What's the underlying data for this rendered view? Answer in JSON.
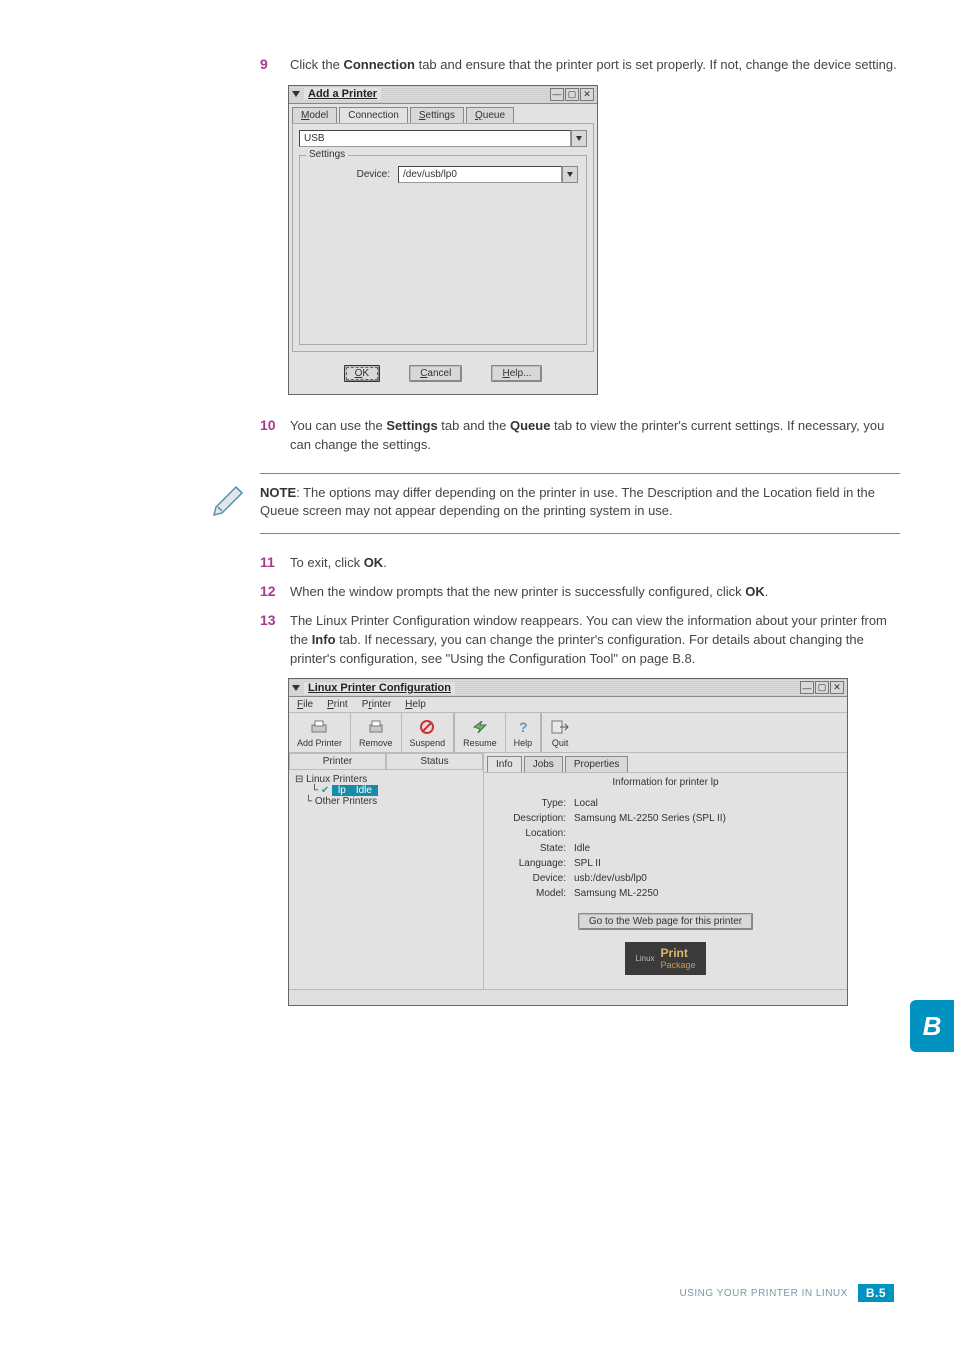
{
  "step9": {
    "num": "9",
    "text_pre": "Click the ",
    "bold1": "Connection",
    "text_mid": " tab and ensure that the printer port is set properly. If not, change the device setting."
  },
  "dialog_add": {
    "title": "Add a Printer",
    "win_btns": {
      "min": "—",
      "max": "▢",
      "close": "✕"
    },
    "tabs": {
      "model": "Model",
      "connection": "Connection",
      "settings": "Settings",
      "queue": "Queue"
    },
    "combo_type": "USB",
    "fieldset_label": "Settings",
    "device_label": "Device:",
    "device_value": "/dev/usb/lp0",
    "buttons": {
      "ok_u": "O",
      "ok": "K",
      "cancel_u": "C",
      "cancel": "ancel",
      "help_u": "H",
      "help": "elp..."
    }
  },
  "step10": {
    "num": "10",
    "p1_pre": "You can use the ",
    "p1_b1": "Settings",
    "p1_mid": " tab and the ",
    "p1_b2": "Queue",
    "p1_post": " tab to view the printer's current settings. If necessary, you can change the settings."
  },
  "note": {
    "label": "NOTE",
    "text": ": The options may differ depending on the printer in use. The Description and the Location field in the Queue screen may not appear depending on the printing system in use."
  },
  "step11": {
    "num": "11",
    "pre": "To exit, click ",
    "b": "OK",
    "post": "."
  },
  "step12": {
    "num": "12",
    "pre": "When the window prompts that the new printer is successfully configured, click ",
    "b": "OK",
    "post": "."
  },
  "step13": {
    "num": "13",
    "pre": "The Linux Printer Configuration window reappears. You can view the information about your printer from the ",
    "b1": "Info",
    "mid": " tab. If necessary, you can change the printer's configuration. For details about changing the printer's configuration, see \"Using the Configuration Tool\" on page B.8."
  },
  "dialog_lpc": {
    "title": "Linux Printer Configuration",
    "menus": {
      "file": "File",
      "print": "Print",
      "printer": "Printer",
      "help": "Help"
    },
    "toolbar": {
      "add_printer": "Add Printer",
      "remove": "Remove",
      "suspend": "Suspend",
      "resume": "Resume",
      "help": "Help",
      "quit": "Quit"
    },
    "left_tabs": {
      "printer": "Printer",
      "status": "Status"
    },
    "tree": {
      "root": "Linux Printers",
      "sel_name": "lp",
      "sel_status": "Idle",
      "other": "Other Printers"
    },
    "right_tabs": {
      "info": "Info",
      "jobs": "Jobs",
      "properties": "Properties"
    },
    "info_header": "Information for printer lp",
    "info": {
      "type_l": "Type:",
      "type_v": "Local",
      "desc_l": "Description:",
      "desc_v": "Samsung ML-2250 Series (SPL II)",
      "loc_l": "Location:",
      "loc_v": "",
      "state_l": "State:",
      "state_v": "Idle",
      "lang_l": "Language:",
      "lang_v": "SPL II",
      "dev_l": "Device:",
      "dev_v": "usb:/dev/usb/lp0",
      "model_l": "Model:",
      "model_v": "Samsung ML-2250"
    },
    "web_btn": "Go to the Web page for this printer",
    "logo_small": "Linux",
    "logo_big": "Print",
    "logo_sub": "Package"
  },
  "footer": {
    "text": "Using Your Printer in Linux",
    "page": "B.5"
  },
  "side_b": "B",
  "chart_data": null
}
